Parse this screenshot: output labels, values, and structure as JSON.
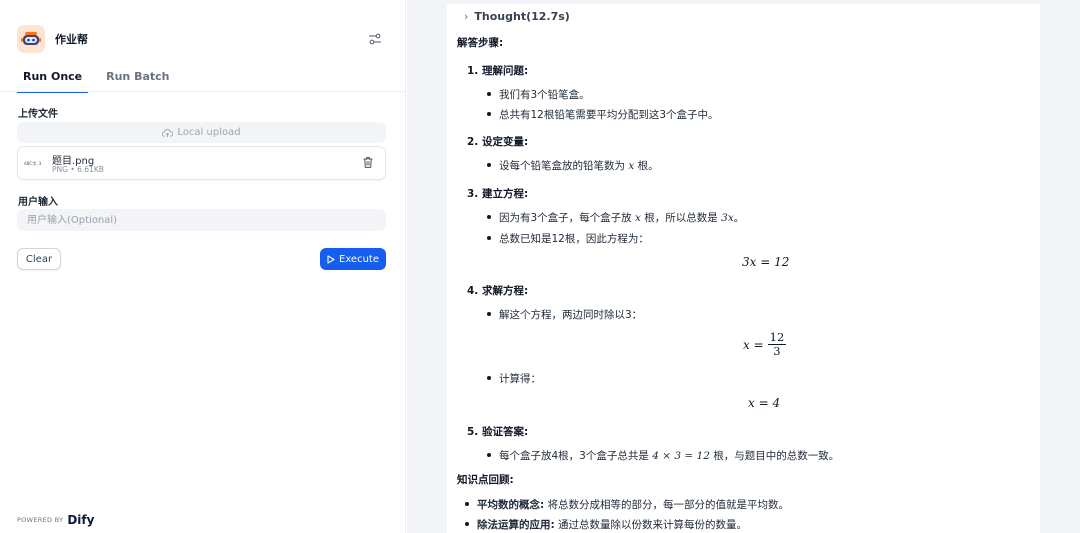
{
  "app": {
    "name": "作业帮"
  },
  "tabs": [
    {
      "label": "Run Once",
      "active": true
    },
    {
      "label": "Run Batch",
      "active": false
    }
  ],
  "form": {
    "upload_label": "上传文件",
    "upload_button": "Local upload",
    "file": {
      "name": "题目.png",
      "type": "PNG",
      "size": "6.61KB",
      "thumb_text": "ABC字, 3"
    },
    "input_label": "用户输入",
    "input_placeholder": "用户输入(Optional)",
    "input_value": "",
    "clear_label": "Clear",
    "execute_label": "Execute"
  },
  "footer": {
    "powered_label": "POWERED BY",
    "brand": "Dify"
  },
  "colors": {
    "accent": "#155eef",
    "panel_bg": "#f3f4f7",
    "icon_bg": "#ffe4d4"
  },
  "answer": {
    "thought_label": "Thought(12.7s)",
    "heading": "解答步骤:",
    "steps": [
      {
        "title": "1. 理解问题:",
        "items": [
          "我们有3个铅笔盒。",
          "总共有12根铅笔需要平均分配到这3个盒子中。"
        ]
      },
      {
        "title": "2. 设定变量:",
        "items": [
          "设每个铅笔盒放的铅笔数为",
          "根。"
        ]
      },
      {
        "title": "3. 建立方程:",
        "items": [
          "因为有3个盒子，每个盒子放",
          "根，所以总数是",
          "总数已知是12根，因此方程为："
        ]
      },
      {
        "title": "4. 求解方程:",
        "items": [
          "解这个方程，两边同时除以3：",
          "计算得："
        ]
      },
      {
        "title": "5. 验证答案:",
        "items": [
          "每个盒子放4根，3个盒子总共是",
          "根，与题目中的总数一致。"
        ]
      }
    ],
    "math": {
      "var": "x",
      "total": "3x",
      "equation": "3x = 12",
      "frac_lhs": "x =",
      "frac_num": "12",
      "frac_den": "3",
      "result": "x = 4",
      "verify": "4 × 3 = 12"
    },
    "review_heading": "知识点回顾:",
    "review": [
      {
        "term": "平均数的概念:",
        "text": "将总数分成相等的部分，每一部分的值就是平均数。"
      },
      {
        "term": "除法运算的应用:",
        "text": "通过总数量除以份数来计算每份的数量。"
      }
    ]
  }
}
